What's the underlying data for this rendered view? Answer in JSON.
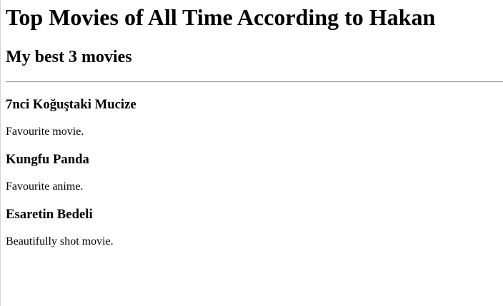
{
  "page": {
    "title": "Top Movies of All Time According to Hakan",
    "subtitle": "My best 3 movies"
  },
  "movies": [
    {
      "title": "7nci Koğuştaki Mucize",
      "description": "Favourite movie."
    },
    {
      "title": "Kungfu Panda",
      "description": "Favourite anime."
    },
    {
      "title": "Esaretin Bedeli",
      "description": "Beautifully shot movie."
    }
  ]
}
